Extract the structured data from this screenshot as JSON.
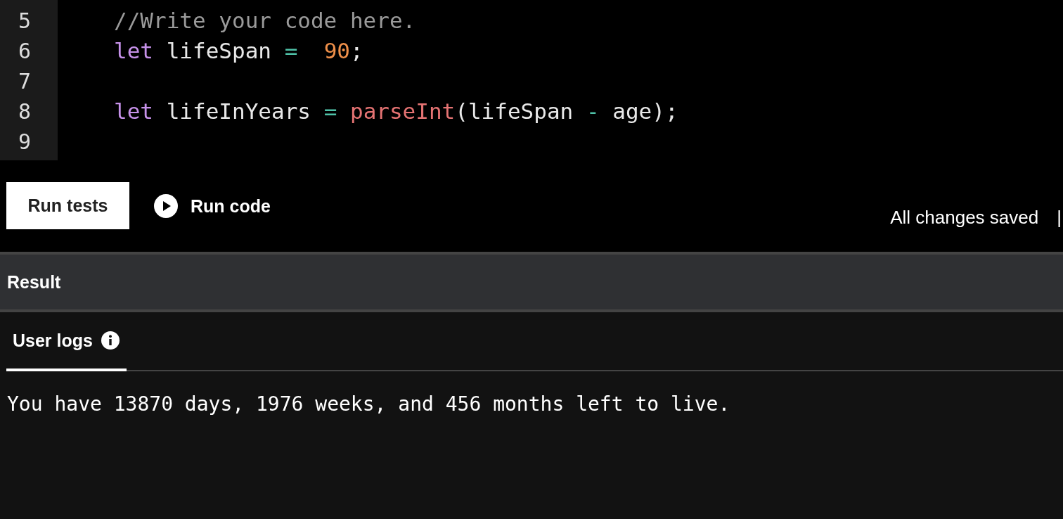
{
  "editor": {
    "lines": [
      {
        "number": "5",
        "tokens": [
          {
            "kind": "comment",
            "text": "//Write your code here."
          }
        ]
      },
      {
        "number": "6",
        "tokens": [
          {
            "kind": "keyword",
            "text": "let"
          },
          {
            "kind": "plain",
            "text": " lifeSpan "
          },
          {
            "kind": "operator",
            "text": "=  "
          },
          {
            "kind": "number",
            "text": "90"
          },
          {
            "kind": "plain",
            "text": ";"
          }
        ]
      },
      {
        "number": "7"
      },
      {
        "number": "8",
        "tokens": [
          {
            "kind": "keyword",
            "text": "let"
          },
          {
            "kind": "plain",
            "text": " lifeInYears "
          },
          {
            "kind": "operator",
            "text": "= "
          },
          {
            "kind": "function",
            "text": "parseInt"
          },
          {
            "kind": "plain",
            "text": "(lifeSpan "
          },
          {
            "kind": "operator",
            "text": "-"
          },
          {
            "kind": "plain",
            "text": " age);"
          }
        ]
      },
      {
        "number": "9"
      }
    ]
  },
  "toolbar": {
    "run_tests": "Run tests",
    "run_code": "Run code",
    "save_status": "All changes saved",
    "separator": "|"
  },
  "result": {
    "title": "Result"
  },
  "tabs": [
    {
      "label": "User logs",
      "selected": true
    }
  ],
  "logs": [
    "You have 13870 days, 1976 weeks, and 456 months left to live."
  ]
}
